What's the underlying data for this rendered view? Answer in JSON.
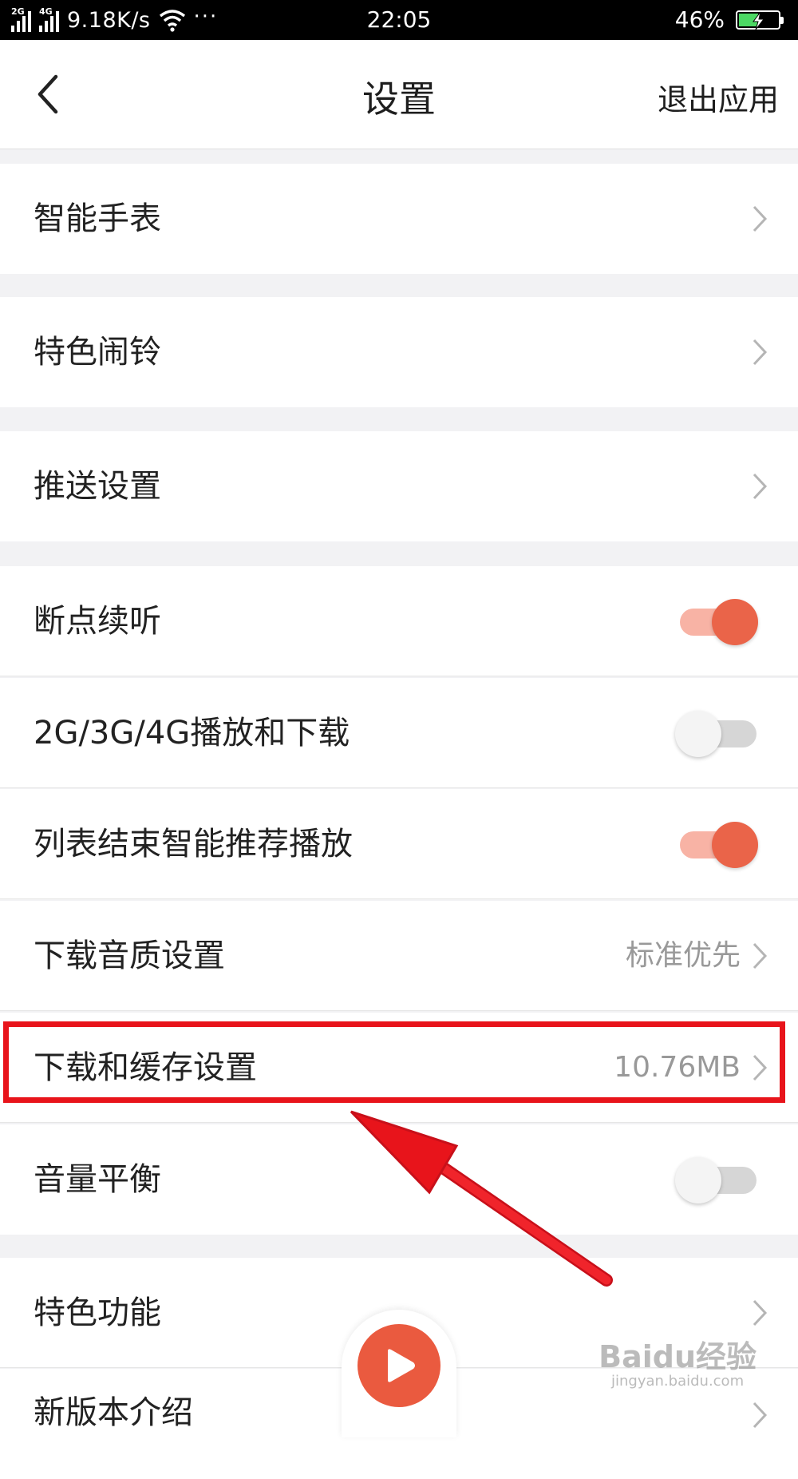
{
  "status_bar": {
    "network_tag_1": "2G",
    "network_tag_2": "4G",
    "speed": "9.18K/s",
    "dots": "···",
    "time": "22:05",
    "battery_percent": "46%",
    "icons": [
      "signal-icon",
      "wifi-icon",
      "battery-charging-icon"
    ]
  },
  "nav": {
    "title": "设置",
    "exit_label": "退出应用",
    "back_icon": "back-arrow-icon"
  },
  "settings": {
    "smart_watch": {
      "label": "智能手表"
    },
    "alarm": {
      "label": "特色闹铃"
    },
    "push": {
      "label": "推送设置"
    },
    "resume_play": {
      "label": "断点续听",
      "enabled": true
    },
    "mobile_data": {
      "label": "2G/3G/4G播放和下载",
      "enabled": false
    },
    "smart_recommend": {
      "label": "列表结束智能推荐播放",
      "enabled": true
    },
    "download_quality": {
      "label": "下载音质设置",
      "value": "标准优先"
    },
    "download_cache": {
      "label": "下载和缓存设置",
      "value": "10.76MB"
    },
    "volume_balance": {
      "label": "音量平衡",
      "enabled": false
    },
    "features": {
      "label": "特色功能"
    },
    "whats_new": {
      "label": "新版本介绍"
    }
  },
  "watermark": {
    "main": "Baidu经验",
    "sub": "jingyan.baidu.com"
  },
  "colors": {
    "accent": "#ea6449",
    "toggle_track_on": "#f8b3a5",
    "highlight": "#e8141b",
    "background": "#f2f2f4"
  }
}
